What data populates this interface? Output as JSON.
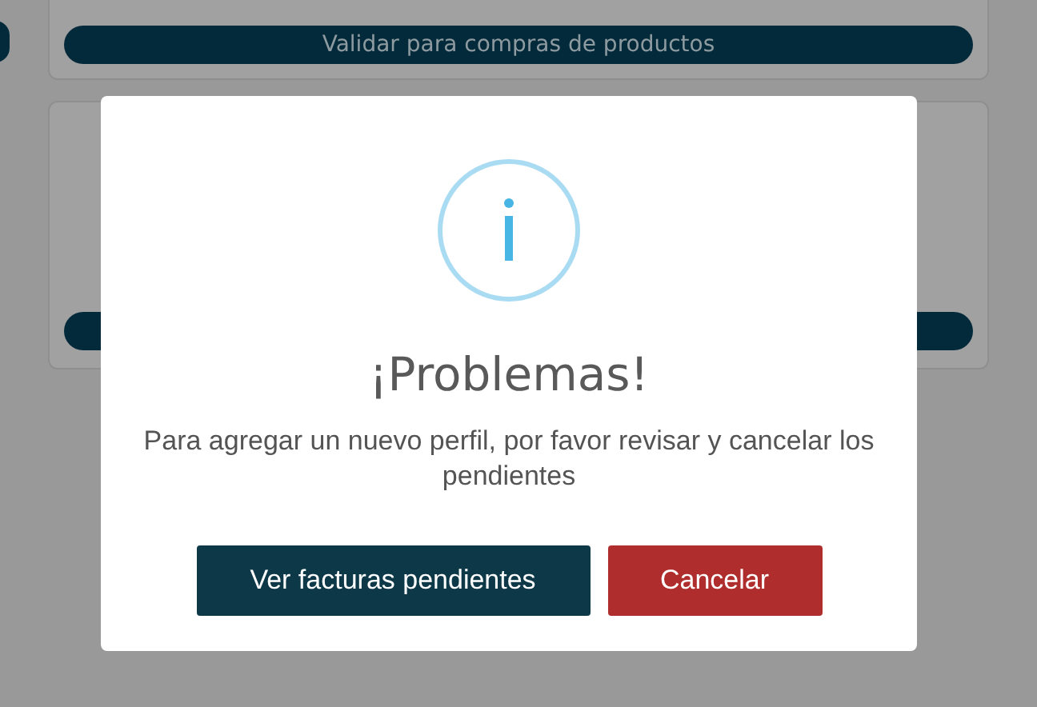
{
  "background_card": {
    "button": "Validar para compras de productos"
  },
  "dialog": {
    "title": "¡Problemas!",
    "message": "Para agregar un nuevo perfil, por favor revisar y cancelar los pendientes",
    "buttons": [
      {
        "label": "Ver facturas pendientes",
        "kind": "primary"
      },
      {
        "label": "Cancelar",
        "kind": "danger"
      }
    ]
  }
}
